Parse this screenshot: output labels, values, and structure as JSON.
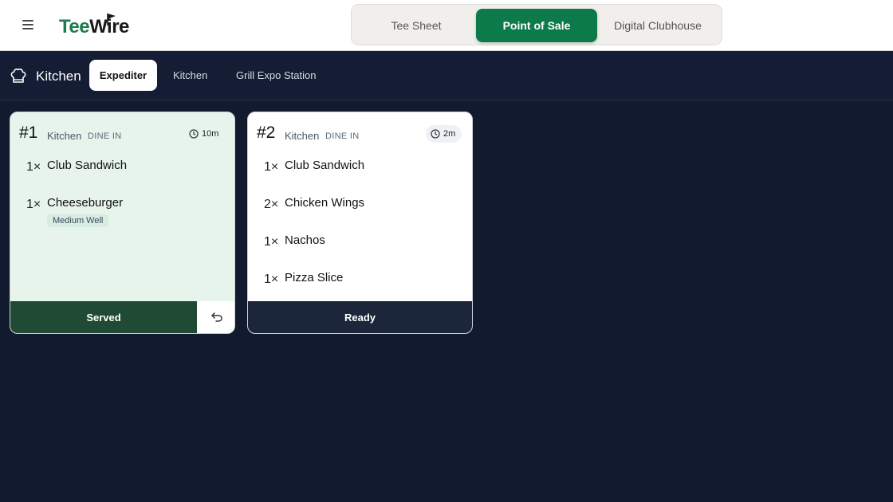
{
  "header": {
    "logo": {
      "part1": "Tee",
      "part2": "Wire"
    },
    "modes": [
      {
        "label": "Tee Sheet",
        "active": false
      },
      {
        "label": "Point of Sale",
        "active": true
      },
      {
        "label": "Digital Clubhouse",
        "active": false
      }
    ],
    "icons": {
      "menu": "hamburger-icon",
      "flag": "flag-icon"
    }
  },
  "station_bar": {
    "title": "Kitchen",
    "icon": "chef-hat-icon",
    "tabs": [
      {
        "label": "Expediter",
        "active": true
      },
      {
        "label": "Kitchen",
        "active": false
      },
      {
        "label": "Grill Expo Station",
        "active": false
      }
    ]
  },
  "orders": [
    {
      "number": "#1",
      "station": "Kitchen",
      "type": "DINE IN",
      "elapsed": "10m",
      "items": [
        {
          "qty": "1×",
          "name": "Club Sandwich"
        },
        {
          "qty": "1×",
          "name": "Cheeseburger",
          "modifier": "Medium Well"
        }
      ],
      "action_label": "Served",
      "secondary_icon": "undo-icon",
      "status": "served"
    },
    {
      "number": "#2",
      "station": "Kitchen",
      "type": "DINE IN",
      "elapsed": "2m",
      "items": [
        {
          "qty": "1×",
          "name": "Club Sandwich"
        },
        {
          "qty": "2×",
          "name": "Chicken Wings"
        },
        {
          "qty": "1×",
          "name": "Nachos"
        },
        {
          "qty": "1×",
          "name": "Pizza Slice"
        }
      ],
      "action_label": "Ready",
      "status": "in-progress"
    }
  ],
  "colors": {
    "brand_green": "#0d7a4a",
    "served_green": "#214a34",
    "page_bg": "#111a2e",
    "card_served_bg": "#e6f4ec"
  }
}
